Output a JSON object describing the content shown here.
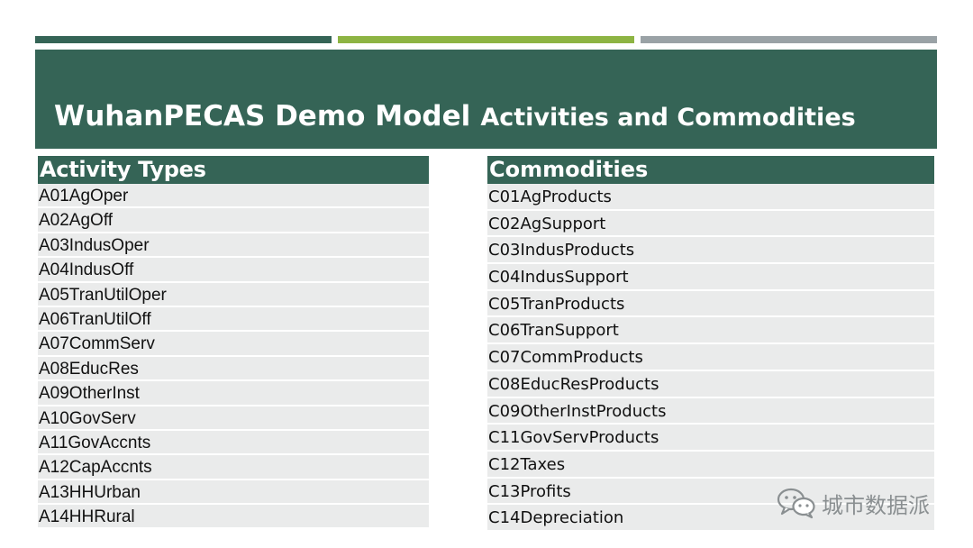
{
  "slide": {
    "title_main": "WuhanPECAS Demo Model",
    "title_sub": "Activities and Commodities"
  },
  "activities": {
    "header": "Activity Types",
    "rows": [
      "A01AgOper",
      "A02AgOff",
      "A03IndusOper",
      "A04IndusOff",
      "A05TranUtilOper",
      "A06TranUtilOff",
      "A07CommServ",
      "A08EducRes",
      "A09OtherInst",
      "A10GovServ",
      "A11GovAccnts",
      "A12CapAccnts",
      "A13HHUrban",
      "A14HHRural"
    ]
  },
  "commodities": {
    "header": "Commodities",
    "rows": [
      "C01AgProducts",
      "C02AgSupport",
      "C03IndusProducts",
      "C04IndusSupport",
      "C05TranProducts",
      "C06TranSupport",
      "C07CommProducts",
      "C08EducResProducts",
      "C09OtherInstProducts",
      "C11GovServProducts",
      "C12Taxes",
      "C13Profits",
      "C14Depreciation"
    ]
  },
  "watermark": {
    "icon": "wechat-icon",
    "text": "城市数据派"
  },
  "colors": {
    "primary_green": "#356456",
    "accent_lime": "#8db443",
    "accent_gray": "#9aa2a6",
    "row_bg": "#eaebeb"
  }
}
